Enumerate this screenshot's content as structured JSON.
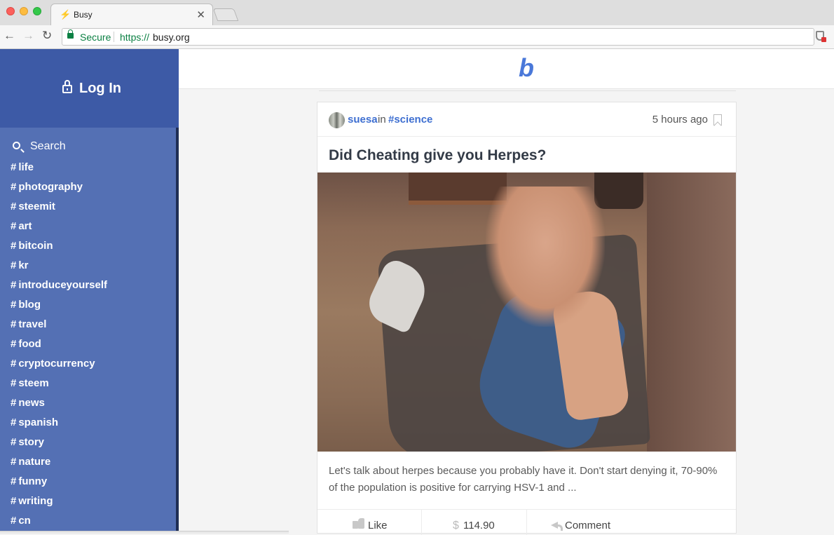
{
  "browser": {
    "tab_title": "Busy",
    "tab_close": "✕",
    "secure_label": "Secure",
    "url_scheme": "https://",
    "url_host": "busy.org"
  },
  "sidebar": {
    "login_label": "Log In",
    "search_label": "Search",
    "tags": [
      "life",
      "photography",
      "steemit",
      "art",
      "bitcoin",
      "kr",
      "introduceyourself",
      "blog",
      "travel",
      "food",
      "cryptocurrency",
      "steem",
      "news",
      "spanish",
      "story",
      "nature",
      "funny",
      "writing",
      "cn"
    ],
    "hash_symbol": "#"
  },
  "header": {
    "brand": "b"
  },
  "post": {
    "author": "suesa",
    "in_label": "in",
    "category": "#science",
    "time_ago": "5 hours ago",
    "title": "Did Cheating give you Herpes?",
    "excerpt": "Let's talk about herpes because you probably have it. Don't start denying it, 70-90% of the population is positive for carrying HSV-1 and ...",
    "like_label": "Like",
    "dollar_symbol": "$",
    "payout": "$114.90",
    "comment_label": "Comment"
  },
  "colors": {
    "sidebar_bg": "#5470b4",
    "login_bg": "#3d5aa6",
    "accent": "#3e6fd1",
    "brand": "#4a78d9"
  }
}
